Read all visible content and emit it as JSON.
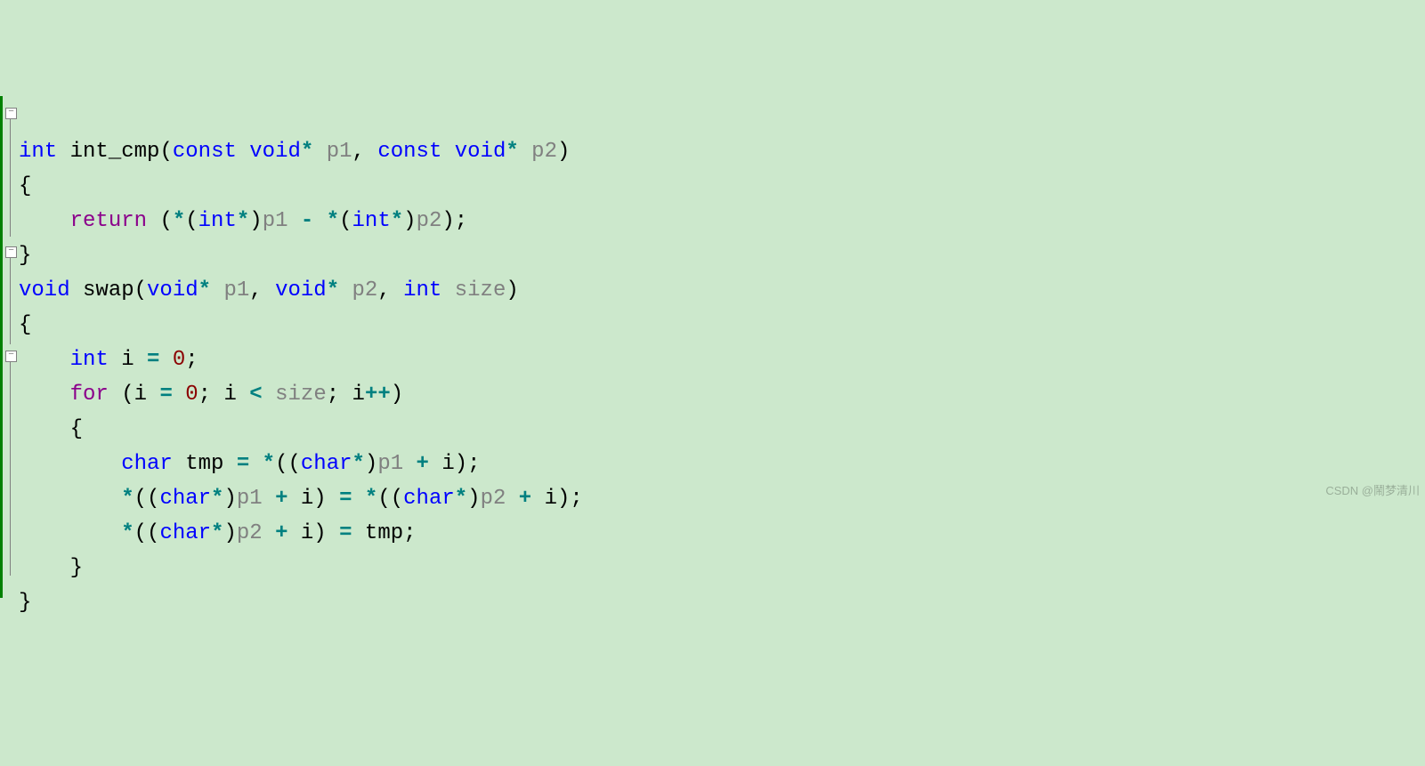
{
  "watermark": "CSDN @鬧梦清川",
  "code": {
    "line1": {
      "t_int": "int",
      "fn": "int_cmp",
      "lp": "(",
      "t_const1": "const",
      "t_void1": "void",
      "star1": "*",
      "p1": "p1",
      "comma": ",",
      "t_const2": "const",
      "t_void2": "void",
      "star2": "*",
      "p2": "p2",
      "rp": ")"
    },
    "line2": {
      "brace": "{"
    },
    "line3": {
      "ret": "return",
      "lp": "(",
      "star1": "*",
      "lp2": "(",
      "t_int1": "int",
      "star2": "*",
      "rp2": ")",
      "p1": "p1",
      "minus": "-",
      "star3": "*",
      "lp3": "(",
      "t_int2": "int",
      "star4": "*",
      "rp3": ")",
      "p2": "p2",
      "rp": ")",
      "semi": ";"
    },
    "line4": {
      "brace": "}"
    },
    "line5": {
      "t_void": "void",
      "fn": "swap",
      "lp": "(",
      "t_void1": "void",
      "star1": "*",
      "p1": "p1",
      "comma1": ",",
      "t_void2": "void",
      "star2": "*",
      "p2": "p2",
      "comma2": ",",
      "t_int": "int",
      "size": "size",
      "rp": ")"
    },
    "line6": {
      "brace": "{"
    },
    "line7": {
      "t_int": "int",
      "i": "i",
      "eq": "=",
      "zero": "0",
      "semi": ";"
    },
    "line8": {
      "for": "for",
      "lp": "(",
      "i1": "i",
      "eq": "=",
      "zero": "0",
      "semi1": ";",
      "i2": "i",
      "lt": "<",
      "size": "size",
      "semi2": ";",
      "i3": "i",
      "inc": "++",
      "rp": ")"
    },
    "line9": {
      "brace": "{"
    },
    "line10": {
      "t_char": "char",
      "tmp": "tmp",
      "eq": "=",
      "star1": "*",
      "lp1": "(",
      "lp2": "(",
      "t_char2": "char",
      "star2": "*",
      "rp2": ")",
      "p1": "p1",
      "plus": "+",
      "i": "i",
      "rp1": ")",
      "semi": ";"
    },
    "line11": {
      "star1": "*",
      "lp1": "(",
      "lp2": "(",
      "t_char1": "char",
      "star2": "*",
      "rp2": ")",
      "p1": "p1",
      "plus1": "+",
      "i1": "i",
      "rp1": ")",
      "eq": "=",
      "star3": "*",
      "lp3": "(",
      "lp4": "(",
      "t_char2": "char",
      "star4": "*",
      "rp4": ")",
      "p2": "p2",
      "plus2": "+",
      "i2": "i",
      "rp3": ")",
      "semi": ";"
    },
    "line12": {
      "star1": "*",
      "lp1": "(",
      "lp2": "(",
      "t_char": "char",
      "star2": "*",
      "rp2": ")",
      "p2": "p2",
      "plus": "+",
      "i": "i",
      "rp1": ")",
      "eq": "=",
      "tmp": "tmp",
      "semi": ";"
    },
    "line13": {
      "brace": "}"
    },
    "line14": {
      "brace": "}"
    }
  }
}
